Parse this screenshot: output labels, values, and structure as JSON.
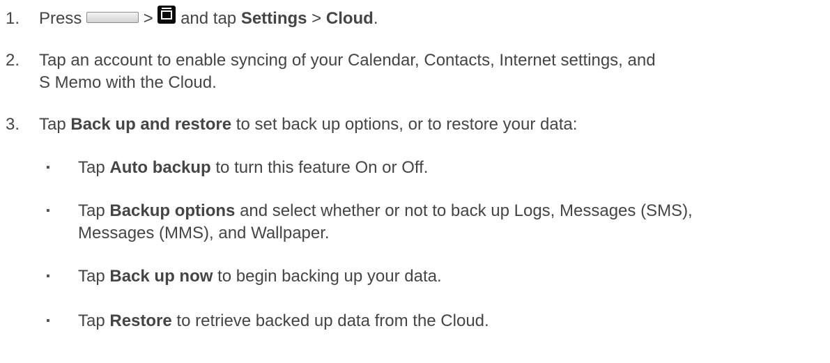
{
  "steps": [
    {
      "number": "1.",
      "text_press": "Press",
      "gt1": ">",
      "text_tap": "and tap",
      "settings": "Settings",
      "gt2": ">",
      "cloud": "Cloud",
      "end": ".",
      "icons": [
        "home-key-icon",
        "menu-key-icon"
      ]
    },
    {
      "number": "2.",
      "line1": "Tap an account to enable syncing of your Calendar, Contacts, Internet settings, and",
      "line2": "S Memo with the Cloud."
    },
    {
      "number": "3.",
      "pre": "Tap",
      "bold": "Back up and restore",
      "post": "to set back up options, or to restore your data:"
    }
  ],
  "bullet_char": "▪",
  "bullets": [
    {
      "pre": "Tap",
      "bold": "Auto backup",
      "post": "to turn this feature On or Off."
    },
    {
      "pre": "Tap",
      "bold": "Backup options",
      "post": "and select whether or not to back up Logs, Messages (SMS),",
      "line2": "Messages (MMS), and Wallpaper."
    },
    {
      "pre": "Tap",
      "bold": "Back up now",
      "post": "to begin backing up your data."
    },
    {
      "pre": "Tap",
      "bold": "Restore",
      "post": "to retrieve backed up data from the Cloud."
    }
  ]
}
